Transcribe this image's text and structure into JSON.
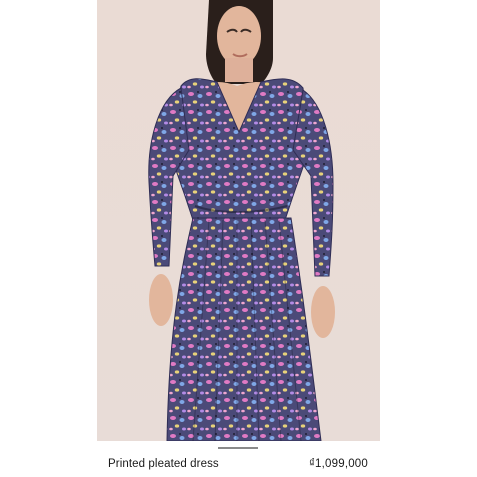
{
  "product": {
    "name": "Printed pleated dress",
    "price": "₫1,099,000",
    "image_alt": "model wearing floral printed pleated dress",
    "colors": {
      "background": "#e9ddd6",
      "dress_base": "#4b4a78",
      "print_pink": "#e07ac4",
      "print_blue": "#7fa7e6",
      "print_yellow": "#e7d27a",
      "skin": "#e2b69c",
      "hair": "#2a1f1b"
    }
  },
  "carousel": {
    "active_index": 1
  }
}
